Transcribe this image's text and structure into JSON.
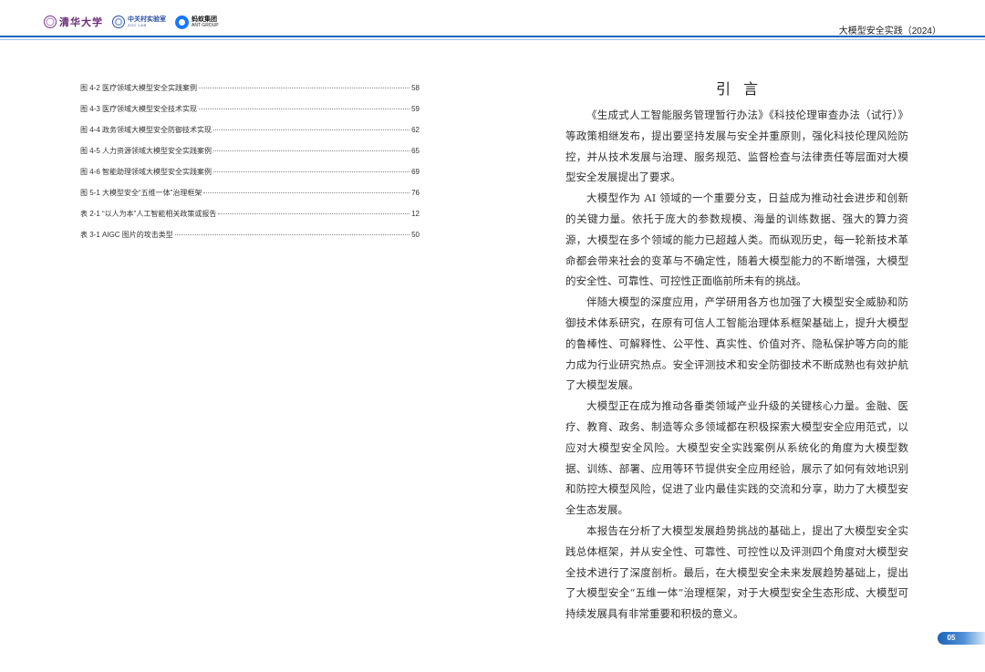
{
  "header": {
    "logos": {
      "tsinghua": "清华大学",
      "zgc_cn": "中关村实验室",
      "zgc_en": "ZGC LAB",
      "ant_cn": "蚂蚁集团",
      "ant_en": "ANT GROUP"
    },
    "title": "大模型安全实践（2024）",
    "colors": {
      "rule": "#1e63b8",
      "rule_light": "#9fbfe3"
    }
  },
  "toc": [
    {
      "label": "图 4-2 医疗领域大模型安全实践案例",
      "page": "58"
    },
    {
      "label": "图 4-3 医疗领域大模型安全技术实现",
      "page": "59"
    },
    {
      "label": "图 4-4 政务领域大模型安全防御技术实现",
      "page": "62"
    },
    {
      "label": "图 4-5 人力资源领域大模型安全实践案例",
      "page": "65"
    },
    {
      "label": "图 4-6 智能助理领域大模型安全实践案例",
      "page": "69"
    },
    {
      "label": "图 5-1 大模型安全“五维一体”治理框架",
      "page": "76"
    },
    {
      "label": "表 2-1 “以人为本”人工智能相关政策或报告",
      "page": "12"
    },
    {
      "label": "表 3-1 AIGC 图片的攻击类型",
      "page": "50"
    }
  ],
  "intro": {
    "title": "引言",
    "paragraphs": [
      "《生成式人工智能服务管理暂行办法》《科技伦理审查办法（试行）》等政策相继发布，提出要坚持发展与安全并重原则，强化科技伦理风险防控，并从技术发展与治理、服务规范、监督检查与法律责任等层面对大模型安全发展提出了要求。",
      "大模型作为 AI 领域的一个重要分支，日益成为推动社会进步和创新的关键力量。依托于庞大的参数规模、海量的训练数据、强大的算力资源，大模型在多个领域的能力已超越人类。而纵观历史，每一轮新技术革命都会带来社会的变革与不确定性，随着大模型能力的不断增强，大模型的安全性、可靠性、可控性正面临前所未有的挑战。",
      "伴随大模型的深度应用，产学研用各方也加强了大模型安全威胁和防御技术体系研究，在原有可信人工智能治理体系框架基础上，提升大模型的鲁棒性、可解释性、公平性、真实性、价值对齐、隐私保护等方向的能力成为行业研究热点。安全评测技术和安全防御技术不断成熟也有效护航了大模型发展。",
      "大模型正在成为推动各垂类领域产业升级的关键核心力量。金融、医疗、教育、政务、制造等众多领域都在积极探索大模型安全应用范式，以应对大模型安全风险。大模型安全实践案例从系统化的角度为大模型数据、训练、部署、应用等环节提供安全应用经验，展示了如何有效地识别和防控大模型风险，促进了业内最佳实践的交流和分享，助力了大模型安全生态发展。",
      "本报告在分析了大模型发展趋势挑战的基础上，提出了大模型安全实践总体框架，并从安全性、可靠性、可控性以及评测四个角度对大模型安全技术进行了深度剖析。最后，在大模型安全未来发展趋势基础上，提出了大模型安全“五维一体”治理框架，对于大模型安全生态形成、大模型可持续发展具有非常重要和积极的意义。"
    ]
  },
  "footer": {
    "page_number": "05",
    "badge_color": "#1e63b8"
  }
}
